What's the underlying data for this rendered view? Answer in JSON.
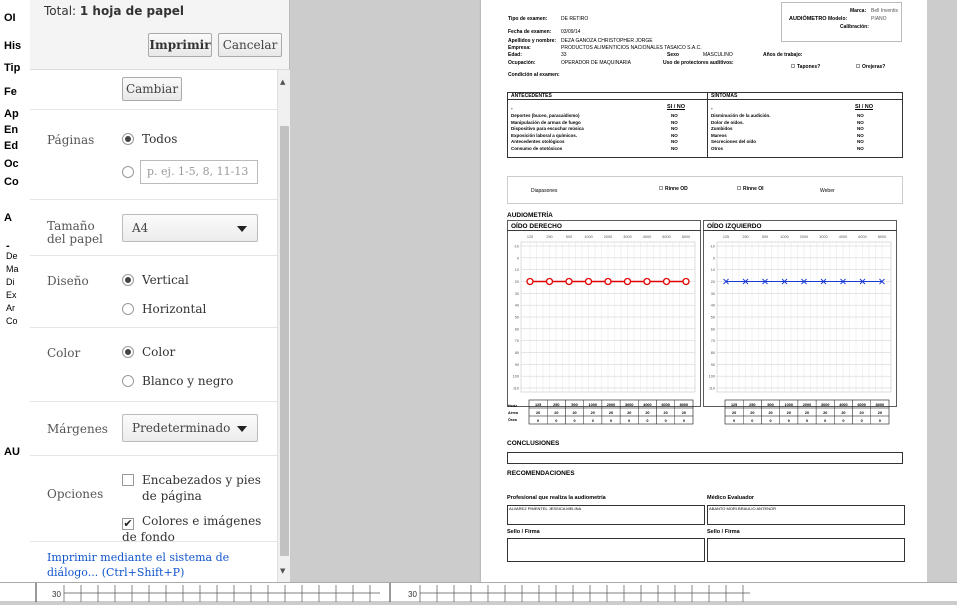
{
  "background_page": {
    "letters": [
      "OI",
      "His",
      "Tip",
      "Fe",
      "Ap",
      "En",
      "Ed",
      "Oc",
      "Co",
      "A",
      "-",
      "De",
      "Ma",
      "Di",
      "Ex",
      "Ar",
      "Co",
      "AU"
    ],
    "bottom_ticks": [
      "30",
      "30"
    ]
  },
  "print_dialog": {
    "total_prefix": "Total:",
    "total_value": "1 hoja de papel",
    "print_button": "Imprimir",
    "cancel_button": "Cancelar",
    "change_button": "Cambiar",
    "pages": {
      "label": "Páginas",
      "option_all": "Todos",
      "range_placeholder": "p. ej. 1-5, 8, 11-13"
    },
    "paper_size": {
      "label": "Tamaño del papel",
      "value": "A4"
    },
    "layout": {
      "label": "Diseño",
      "option_vertical": "Vertical",
      "option_horizontal": "Horizontal"
    },
    "color": {
      "label": "Color",
      "option_color": "Color",
      "option_bw": "Blanco y negro"
    },
    "margins": {
      "label": "Márgenes",
      "value": "Predeterminado"
    },
    "options": {
      "label": "Opciones",
      "headers_footers": "Encabezados y pies de página",
      "bg_colors": "Colores e imágenes de fondo"
    },
    "system_dialog_link": "Imprimir mediante el sistema de diálogo... (Ctrl+Shift+P)"
  },
  "document": {
    "fields": {
      "tipo_label": "Tipo de examen:",
      "tipo_value": "DE RETIRO",
      "fecha_label": "Fecha de examen:",
      "fecha_value": "03/09/14",
      "nombre_label": "Apellidos y nombre:",
      "nombre_value": "DEZA GANOZA CHRISTOPHER JORGE",
      "empresa_label": "Empresa:",
      "empresa_value": "PRODUCTOS ALIMENTICIOS NACIONALES TASAICO S.A.C.",
      "edad_label": "Edad:",
      "edad_value": "33",
      "sexo_label": "Sexo",
      "sexo_value": "MASCULINO",
      "anios_label": "Años de trabajo:",
      "ocupacion_label": "Ocupación:",
      "ocupacion_value": "OPERADOR DE MAQUINARIA",
      "protectores_label": "Uso de protectores auditivos:",
      "tapones": "Tapones?",
      "orejeras": "Orejeras?",
      "condicion_label": "Condición al examen:"
    },
    "audiometro": {
      "title": "AUDIÓMETRO",
      "marca_label": "Marca:",
      "marca_value": "Bell Inventis",
      "modelo_label": "Modelo:",
      "modelo_value": "PIANO",
      "calibracion_label": "Calibración:"
    },
    "antecedentes": {
      "title": "ANTECEDENTES",
      "sino": "SI / NO",
      "dash": "-",
      "items": [
        {
          "label": "Deportes (buceo, paracaidismo)",
          "value": "NO"
        },
        {
          "label": "Manipulación de armas de fuego",
          "value": "NO"
        },
        {
          "label": "Dispositivo para escuchar música",
          "value": "NO"
        },
        {
          "label": "Exposición laboral a químicos.",
          "value": "NO"
        },
        {
          "label": "Antecedentes otológicos",
          "value": "NO"
        },
        {
          "label": "Consumo de ototóxicos",
          "value": "NO"
        }
      ]
    },
    "sintomas": {
      "title": "SÍNTOMAS",
      "sino": "SI / NO",
      "dash": "-",
      "items": [
        {
          "label": "Disminución de la audición.",
          "value": "NO"
        },
        {
          "label": "Dolor de oídos.",
          "value": "NO"
        },
        {
          "label": "Zumbidos",
          "value": "NO"
        },
        {
          "label": "Mareos",
          "value": "NO"
        },
        {
          "label": "Secreciones del oído",
          "value": "NO"
        },
        {
          "label": "Otros",
          "value": "NO"
        }
      ]
    },
    "pruebas": {
      "diapasones": "Diapasones",
      "rinne_od": "Rinne OD",
      "rinne_oi": "Rinne OI",
      "weber": "Weber"
    },
    "audiometria_title": "AUDIOMETRÍA",
    "oido_derecho": "OÍDO DERECHO",
    "oido_izquierdo": "OÍDO IZQUIERDO",
    "table_rows": [
      "Hertz",
      "Aérea",
      "Ósea"
    ],
    "conclusiones": "CONCLUSIONES",
    "recomendaciones": "RECOMENDACIONES",
    "profesional_label": "Profesional que realiza la audiometría",
    "profesional_value": "ALVAREZ PIMENTEL JESSICA MELINA",
    "medico_label": "Médico Evaluador",
    "medico_value": "ABANTO MORI BRAULIO ANTENOR",
    "sello1": "Sello / Firma",
    "sello2": "Sello / Firma"
  },
  "chart_data": [
    {
      "type": "line",
      "title": "OÍDO DERECHO",
      "x": [
        "125",
        "250",
        "500",
        "1000",
        "2000",
        "3000",
        "4000",
        "6000",
        "8000"
      ],
      "y_ticks": [
        -10,
        0,
        10,
        20,
        30,
        40,
        50,
        60,
        70,
        80,
        90,
        100,
        110
      ],
      "series": [
        {
          "values": [
            20,
            20,
            20,
            20,
            20,
            20,
            20,
            20,
            20
          ],
          "color": "#e00000"
        }
      ],
      "aerea": [
        "20",
        "20",
        "20",
        "20",
        "20",
        "20",
        "20",
        "20",
        "20"
      ],
      "osea": [
        "0",
        "0",
        "0",
        "0",
        "0",
        "0",
        "0",
        "0",
        "0"
      ],
      "ylim": [
        -10,
        110
      ]
    },
    {
      "type": "line",
      "title": "OÍDO IZQUIERDO",
      "x": [
        "125",
        "250",
        "500",
        "1000",
        "2000",
        "3000",
        "4000",
        "6000",
        "8000"
      ],
      "y_ticks": [
        -10,
        0,
        10,
        20,
        30,
        40,
        50,
        60,
        70,
        80,
        90,
        100,
        110
      ],
      "series": [
        {
          "values": [
            20,
            20,
            20,
            20,
            20,
            20,
            20,
            20,
            20
          ],
          "color": "#1a3ad8"
        }
      ],
      "aerea": [
        "20",
        "20",
        "20",
        "20",
        "20",
        "20",
        "20",
        "20",
        "20"
      ],
      "osea": [
        "0",
        "0",
        "0",
        "0",
        "0",
        "0",
        "0",
        "0",
        "0"
      ],
      "ylim": [
        -10,
        110
      ]
    }
  ]
}
